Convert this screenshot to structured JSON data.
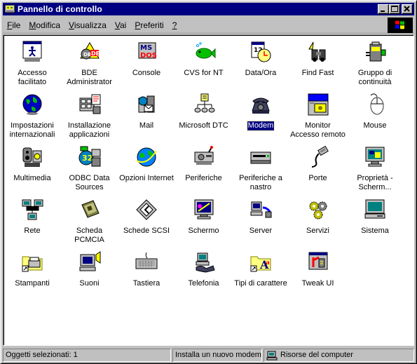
{
  "window": {
    "title": "Pannello di controllo",
    "title_icon": "control-panel-icon",
    "buttons": [
      "minimize-icon",
      "maximize-icon",
      "close-icon"
    ]
  },
  "menu": [
    {
      "label": "File",
      "underline": "F",
      "rest": "ile"
    },
    {
      "label": "Modifica",
      "underline": "M",
      "rest": "odifica"
    },
    {
      "label": "Visualizza",
      "underline": "V",
      "rest": "isualizza"
    },
    {
      "label": "Vai",
      "underline": "V",
      "rest": "ai"
    },
    {
      "label": "Preferiti",
      "underline": "P",
      "rest": "referiti"
    },
    {
      "label": "?",
      "underline": "?",
      "rest": ""
    }
  ],
  "items": [
    {
      "label": "Accesso facilitato",
      "icon": "accessibility-icon"
    },
    {
      "label": "BDE Administrator",
      "icon": "bde-administrator-icon"
    },
    {
      "label": "Console",
      "icon": "console-icon"
    },
    {
      "label": "CVS for NT",
      "icon": "fish-icon"
    },
    {
      "label": "Data/Ora",
      "icon": "calendar-clock-icon"
    },
    {
      "label": "Find Fast",
      "icon": "binoculars-icon"
    },
    {
      "label": "Gruppo di continuità",
      "icon": "ups-battery-icon"
    },
    {
      "label": "Impostazioni internazionali",
      "icon": "globe-icon"
    },
    {
      "label": "Installazione applicazioni",
      "icon": "install-applications-icon"
    },
    {
      "label": "Mail",
      "icon": "mail-icon"
    },
    {
      "label": "Microsoft DTC",
      "icon": "network-transaction-icon"
    },
    {
      "label": "Modem",
      "icon": "modem-phone-icon",
      "selected": true
    },
    {
      "label": "Monitor Accesso remoto",
      "icon": "remote-access-monitor-icon"
    },
    {
      "label": "Mouse",
      "icon": "mouse-icon"
    },
    {
      "label": "Multimedia",
      "icon": "multimedia-icon"
    },
    {
      "label": "ODBC Data Sources",
      "icon": "odbc-icon"
    },
    {
      "label": "Opzioni Internet",
      "icon": "internet-options-icon"
    },
    {
      "label": "Periferiche",
      "icon": "devices-icon"
    },
    {
      "label": "Periferiche a nastro",
      "icon": "tape-drive-icon"
    },
    {
      "label": "Porte",
      "icon": "port-cable-icon"
    },
    {
      "label": "Proprietà - Scherm...",
      "icon": "display-properties-icon"
    },
    {
      "label": "Rete",
      "icon": "network-icon"
    },
    {
      "label": "Scheda PCMCIA",
      "icon": "pcmcia-card-icon"
    },
    {
      "label": "Schede SCSI",
      "icon": "scsi-icon"
    },
    {
      "label": "Schermo",
      "icon": "display-icon"
    },
    {
      "label": "Server",
      "icon": "server-icon"
    },
    {
      "label": "Servizi",
      "icon": "services-gears-icon"
    },
    {
      "label": "Sistema",
      "icon": "system-computer-icon"
    },
    {
      "label": "Stampanti",
      "icon": "printers-folder-icon"
    },
    {
      "label": "Suoni",
      "icon": "sounds-icon"
    },
    {
      "label": "Tastiera",
      "icon": "keyboard-icon"
    },
    {
      "label": "Telefonia",
      "icon": "telephony-icon"
    },
    {
      "label": "Tipi di carattere",
      "icon": "fonts-folder-icon"
    },
    {
      "label": "Tweak UI",
      "icon": "tweak-ui-icon"
    }
  ],
  "status": {
    "left": "Oggetti selezionati: 1",
    "middle": "Installa un nuovo modem",
    "right": "Risorse del computer",
    "right_icon": "my-computer-icon"
  },
  "colors": {
    "title_bar": "#000080",
    "face": "#c0c0c0",
    "selection": "#000080"
  }
}
